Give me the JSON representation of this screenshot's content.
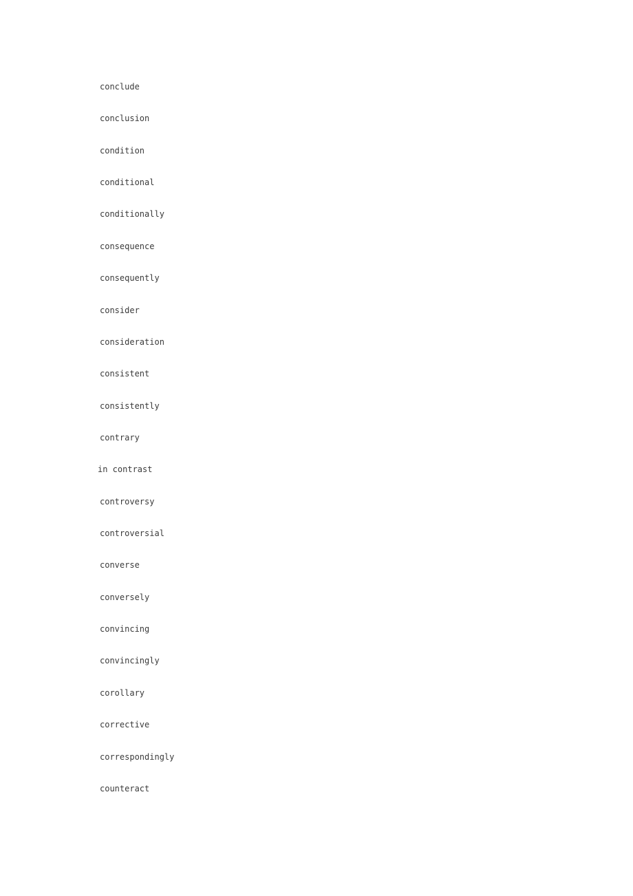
{
  "document": {
    "page_background": "#ffffff",
    "text_color": "#3a3a3a",
    "word_list": [
      {
        "text": "conclude",
        "phrase": false
      },
      {
        "text": "conclusion",
        "phrase": false
      },
      {
        "text": "condition",
        "phrase": false
      },
      {
        "text": "conditional",
        "phrase": false
      },
      {
        "text": "conditionally",
        "phrase": false
      },
      {
        "text": "consequence",
        "phrase": false
      },
      {
        "text": "consequently",
        "phrase": false
      },
      {
        "text": "consider",
        "phrase": false
      },
      {
        "text": "consideration",
        "phrase": false
      },
      {
        "text": "consistent",
        "phrase": false
      },
      {
        "text": "consistently",
        "phrase": false
      },
      {
        "text": "contrary",
        "phrase": false
      },
      {
        "text": "in contrast",
        "phrase": true
      },
      {
        "text": "controversy",
        "phrase": false
      },
      {
        "text": "controversial",
        "phrase": false
      },
      {
        "text": "converse",
        "phrase": false
      },
      {
        "text": "conversely",
        "phrase": false
      },
      {
        "text": "convincing",
        "phrase": false
      },
      {
        "text": "convincingly",
        "phrase": false
      },
      {
        "text": "corollary",
        "phrase": false
      },
      {
        "text": "corrective",
        "phrase": false
      },
      {
        "text": "correspondingly",
        "phrase": false
      },
      {
        "text": "counteract",
        "phrase": false
      }
    ]
  }
}
